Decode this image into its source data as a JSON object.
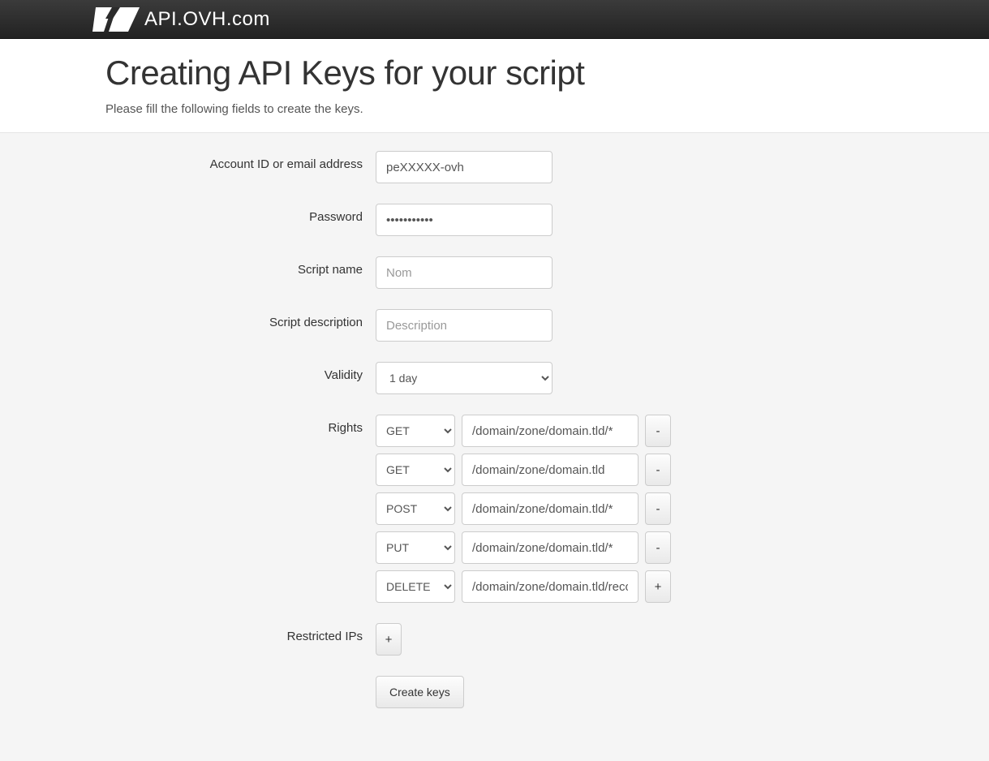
{
  "header": {
    "logo_text": "API.OVH.com",
    "title": "Creating API Keys for your script",
    "subtitle": "Please fill the following fields to create the keys."
  },
  "form": {
    "account": {
      "label": "Account ID or email address",
      "value": "peXXXXX-ovh"
    },
    "password": {
      "label": "Password",
      "value": "•••••••••••"
    },
    "script_name": {
      "label": "Script name",
      "placeholder": "Nom"
    },
    "script_description": {
      "label": "Script description",
      "placeholder": "Description"
    },
    "validity": {
      "label": "Validity",
      "selected": "1 day"
    },
    "rights": {
      "label": "Rights",
      "rows": [
        {
          "method": "GET",
          "path": "/domain/zone/domain.tld/*",
          "action": "-"
        },
        {
          "method": "GET",
          "path": "/domain/zone/domain.tld",
          "action": "-"
        },
        {
          "method": "POST",
          "path": "/domain/zone/domain.tld/*",
          "action": "-"
        },
        {
          "method": "PUT",
          "path": "/domain/zone/domain.tld/*",
          "action": "-"
        },
        {
          "method": "DELETE",
          "path": "/domain/zone/domain.tld/record/*",
          "action": "+"
        }
      ]
    },
    "restricted_ips": {
      "label": "Restricted IPs",
      "action": "+"
    },
    "submit": {
      "label": "Create keys"
    }
  }
}
